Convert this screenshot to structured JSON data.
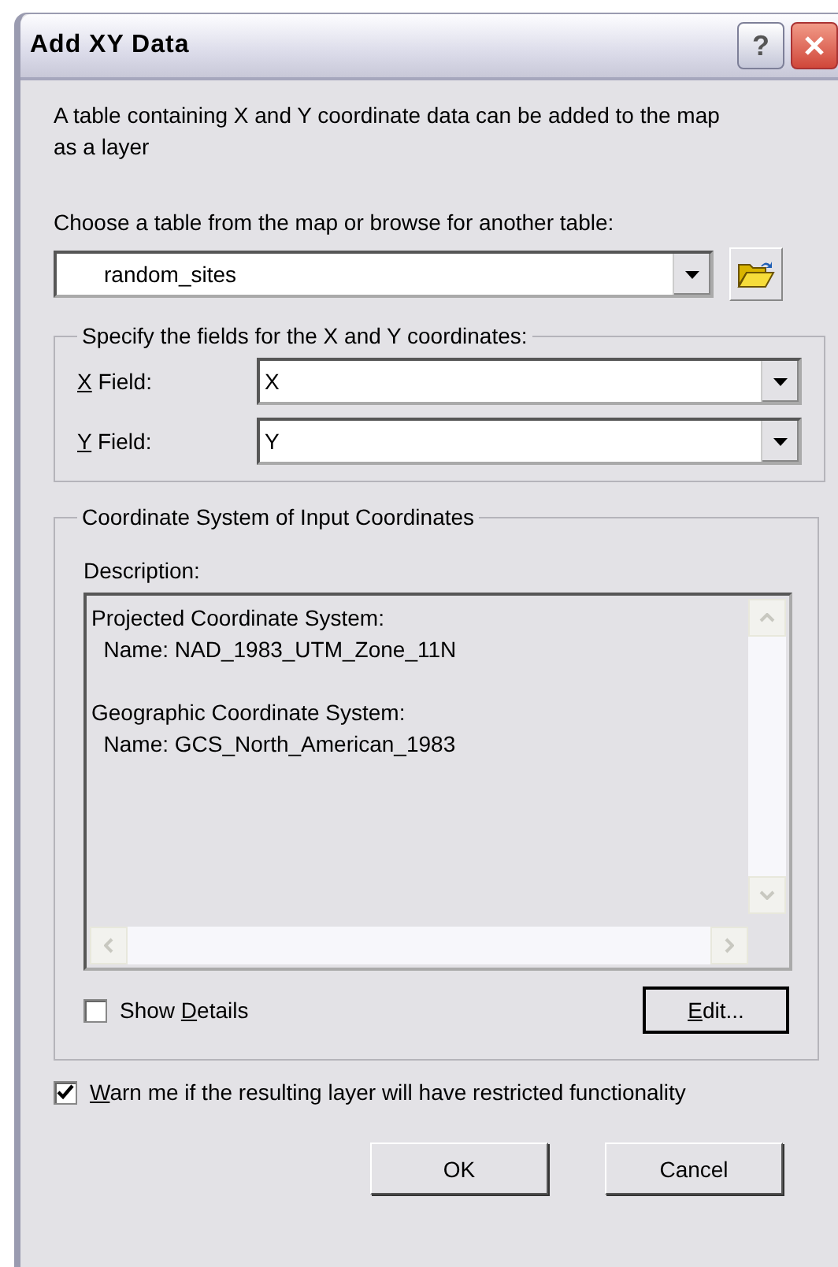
{
  "window": {
    "title": "Add XY Data",
    "buttons": [
      {
        "kind": "help",
        "label": "?"
      },
      {
        "kind": "close"
      }
    ]
  },
  "intro": "A table containing X and Y coordinate data can be added to the map as a layer",
  "table_prompt": "Choose a table from the map or browse for another table:",
  "table_combo": {
    "value": "random_sites"
  },
  "fields_group": {
    "title": "Specify the fields for the X and Y coordinates:",
    "fields": [
      {
        "label": {
          "key": "X",
          "after": " Field:"
        },
        "value": "X"
      },
      {
        "label": {
          "key": "Y",
          "after": " Field:"
        },
        "value": "Y"
      }
    ]
  },
  "coord_group": {
    "title": "Coordinate System of Input Coordinates",
    "description_label": "Description:",
    "description_blocks": [
      [
        "Projected Coordinate System:",
        "  Name: NAD_1983_UTM_Zone_11N"
      ],
      [
        "Geographic Coordinate System:",
        "  Name: GCS_North_American_1983"
      ]
    ],
    "show_details": {
      "label": {
        "before": "Show ",
        "key": "D",
        "after": "etails"
      },
      "checked": false
    },
    "edit_button": {
      "label": {
        "key": "E",
        "after": "dit..."
      }
    }
  },
  "warn": {
    "label": {
      "key": "W",
      "after": "arn me if the resulting layer will have restricted functionality"
    },
    "checked": true
  },
  "buttons": [
    {
      "label": "OK"
    },
    {
      "label": "Cancel"
    }
  ]
}
